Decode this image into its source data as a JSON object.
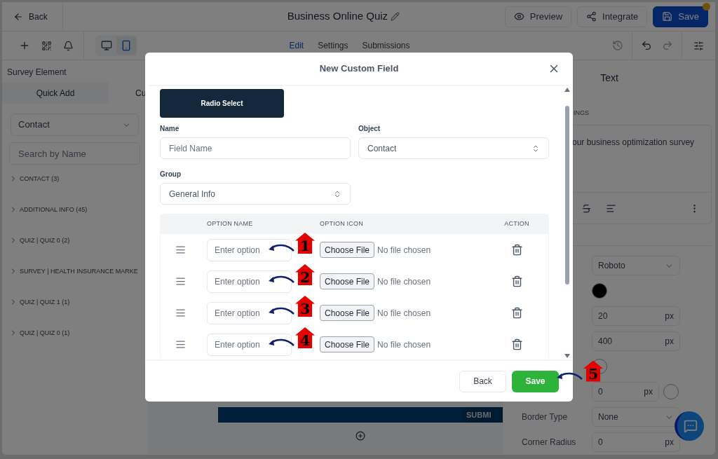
{
  "header": {
    "back": "Back",
    "title": "Business Online Quiz",
    "unsaved": true,
    "buttons": [
      {
        "label": "Preview",
        "kind": "preview"
      },
      {
        "label": "Integrate",
        "kind": "integrate"
      },
      {
        "label": "Save",
        "kind": "save"
      }
    ]
  },
  "view_toggle": [
    {
      "kind": "desktop",
      "selected": false
    },
    {
      "kind": "mobile",
      "selected": true
    }
  ],
  "tabs": [
    {
      "label": "Edit",
      "selected": true
    },
    {
      "label": "Settings",
      "selected": false
    },
    {
      "label": "Submissions",
      "selected": false
    }
  ],
  "sidebar": {
    "title": "Survey Element",
    "tabs": [
      {
        "label": "Quick Add",
        "selected": true
      },
      {
        "label": "Cu",
        "selected": false
      }
    ],
    "object_select": "Contact",
    "search": {
      "placeholder": "Search by Name"
    },
    "groups": [
      "CONTACT (3)",
      "ADDITIONAL INFO (45)",
      "QUIZ | QUIZ 0 (2)",
      "SURVEY | HEALTH INSURANCE MARKE",
      "QUIZ | QUIZ 1 (1)",
      "QUIZ | QUIZ 0 (1)"
    ]
  },
  "canvas": {
    "button": "SUBMI"
  },
  "properties": {
    "title": "Text",
    "section": "INGS",
    "text": "our business optimization survey",
    "rows": [
      {
        "kind": "select",
        "value": "Roboto"
      },
      {
        "kind": "swatch",
        "filled": true
      },
      {
        "kind": "unit",
        "value": "20",
        "unit": "px"
      },
      {
        "kind": "unit",
        "value": "400",
        "unit": "px"
      },
      {
        "kind": "swatch",
        "filled": false
      },
      {
        "kind": "unit",
        "value": "0",
        "unit": "px",
        "swatch": true
      },
      {
        "kind": "select",
        "label": "Border Type",
        "value": "None"
      },
      {
        "kind": "unit",
        "label": "Corner Radius",
        "value": "0",
        "unit": "px"
      }
    ]
  },
  "modal": {
    "title": "New Custom Field",
    "field_type": "Radio Select",
    "fields": [
      {
        "label": "Name",
        "kind": "text",
        "placeholder": "Field Name"
      },
      {
        "label": "Object",
        "kind": "select",
        "value": "Contact"
      },
      {
        "label": "Group",
        "kind": "select",
        "value": "General Info"
      }
    ],
    "options_table": {
      "columns": [
        "OPTION NAME",
        "OPTION ICON",
        "ACTION"
      ],
      "rows": [
        {
          "placeholder": "Enter option",
          "file_button": "Choose File",
          "file_status": "No file chosen",
          "callout": "1"
        },
        {
          "placeholder": "Enter option",
          "file_button": "Choose File",
          "file_status": "No file chosen",
          "callout": "2"
        },
        {
          "placeholder": "Enter option",
          "file_button": "Choose File",
          "file_status": "No file chosen",
          "callout": "3"
        },
        {
          "placeholder": "Enter option",
          "file_button": "Choose File",
          "file_status": "No file chosen",
          "callout": "4"
        }
      ]
    },
    "buttons": [
      {
        "label": "Back",
        "kind": "secondary"
      },
      {
        "label": "Save",
        "kind": "primary",
        "callout": "5"
      }
    ]
  }
}
